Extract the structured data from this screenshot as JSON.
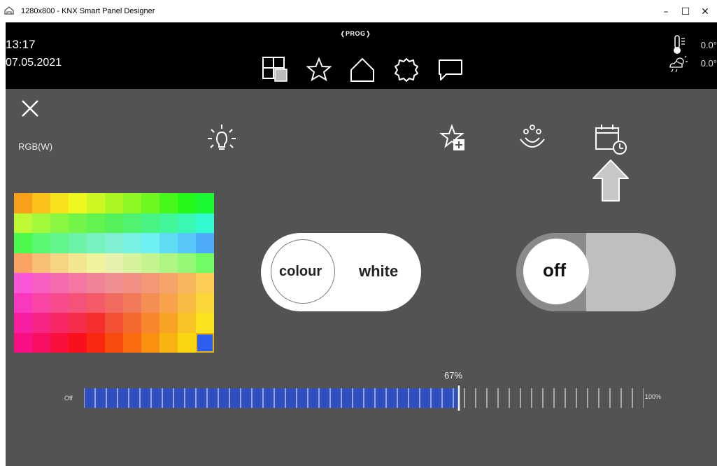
{
  "window": {
    "title": "1280x800 - KNX Smart Panel Designer",
    "minimize": "–",
    "maximize": "☐",
    "close": "✕"
  },
  "topbar": {
    "time": "13:17",
    "date": "07.05.2021",
    "prog_label": "PROG",
    "temperature": "0.0°",
    "weather": "0.0°",
    "nav_icons": [
      "grid-icon",
      "star-icon",
      "home-icon",
      "gear-icon",
      "chat-icon"
    ]
  },
  "main": {
    "mode_label": "RGB(W)",
    "toggle_colour": {
      "left": "colour",
      "right": "white"
    },
    "toggle_power": {
      "label": "off"
    },
    "slider": {
      "value": 67,
      "value_label": "67%",
      "min_label": "Off",
      "max_label": "100%"
    }
  },
  "colors": {
    "panel_bg": "#535353",
    "topbar_bg": "#000000",
    "slider_fill": "#2f4fbf",
    "selection": "#f0b400"
  }
}
